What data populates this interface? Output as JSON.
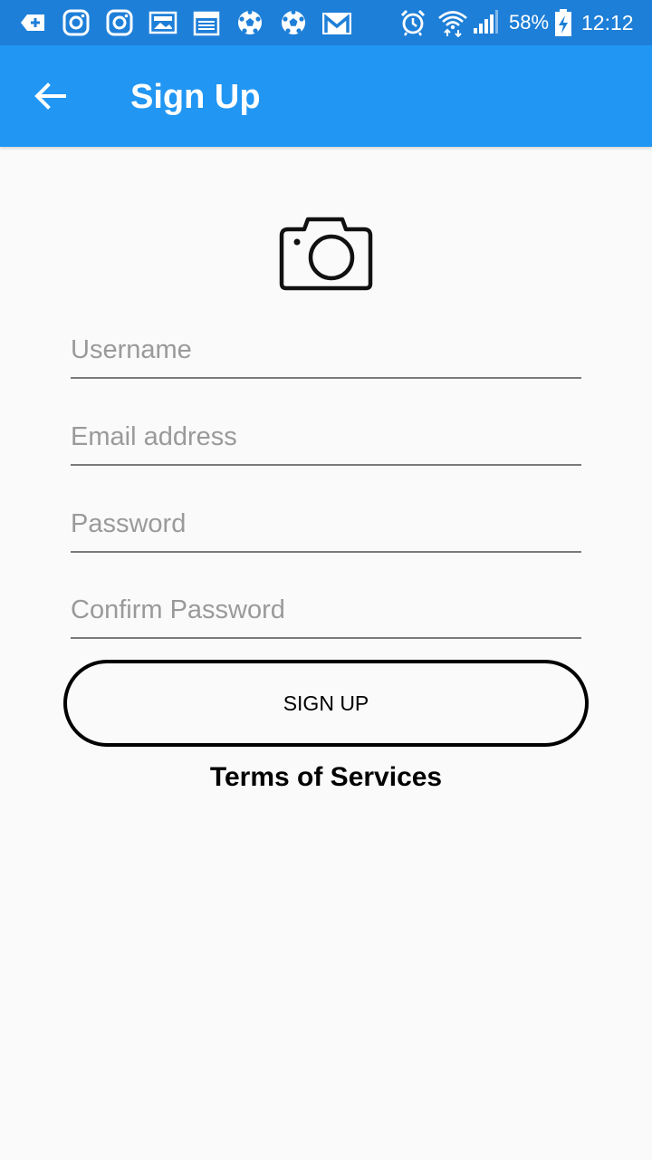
{
  "status_bar": {
    "notification_icons": [
      "add-box-icon",
      "instagram-icon",
      "instagram-icon",
      "gallery-icon",
      "calendar-icon",
      "soccer-ball-icon",
      "soccer-ball-icon",
      "gmail-icon"
    ],
    "system_icons": [
      "alarm-icon",
      "wifi-icon",
      "signal-icon",
      "battery-charging-icon"
    ],
    "battery_percent": "58%",
    "time": "12:12"
  },
  "app_bar": {
    "title": "Sign Up",
    "back_icon": "arrow-back-icon"
  },
  "form": {
    "avatar_icon": "camera-icon",
    "username_placeholder": "Username",
    "email_placeholder": "Email address",
    "password_placeholder": "Password",
    "confirm_password_placeholder": "Confirm Password",
    "signup_label": "SIGN UP",
    "terms_label": "Terms of Services"
  },
  "colors": {
    "status_bar": "#1e7fd8",
    "app_bar": "#2196f3",
    "background": "#fafafa",
    "field_underline": "#7a7a7a",
    "placeholder": "#9a9a9a"
  }
}
